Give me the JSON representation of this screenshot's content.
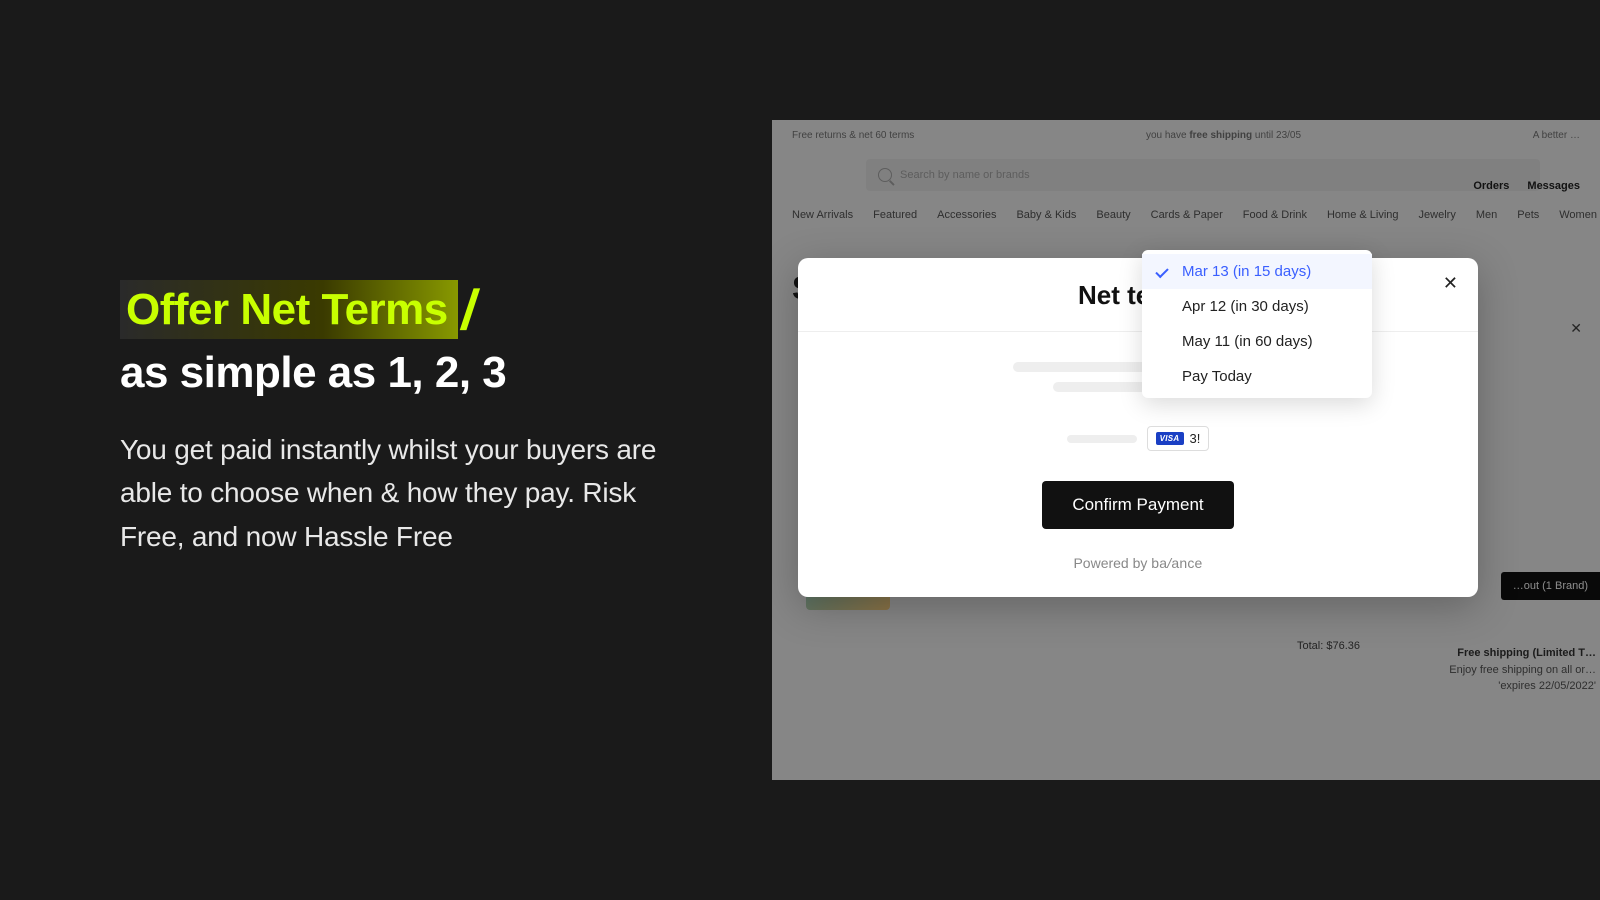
{
  "hero": {
    "line1": "Offer Net Terms",
    "slash": "/",
    "line2": "as simple as 1, 2, 3",
    "body": "You get paid instantly whilst your buyers are able to choose when & how they pay. Risk Free, and now Hassle Free"
  },
  "bg": {
    "promo_left": "Free returns & net 60 terms",
    "promo_mid_pre": "you have ",
    "promo_mid_bold": "free shipping",
    "promo_mid_post": " until 23/05",
    "promo_right": "A better …",
    "search_placeholder": "Search by name or brands",
    "toplinks": {
      "orders": "Orders",
      "messages": "Messages"
    },
    "categories": [
      "New Arrivals",
      "Featured",
      "Accessories",
      "Baby & Kids",
      "Beauty",
      "Cards & Paper",
      "Food & Drink",
      "Home & Living",
      "Jewelry",
      "Men",
      "Pets",
      "Women"
    ],
    "big_initial": "S",
    "total_label": "Total: $76.36",
    "checkout_label": "…out (1 Brand)",
    "ship_title": "Free shipping (Limited T…",
    "ship_body": "Enjoy free shipping on all or…",
    "ship_exp": "'expires 22/05/2022'"
  },
  "modal": {
    "title": "Net terms",
    "close": "✕",
    "card_brand": "VISA",
    "card_digits": "3!",
    "confirm_label": "Confirm Payment",
    "powered_prefix": "Powered by ",
    "powered_brand_a": "ba",
    "powered_brand_slash": "/",
    "powered_brand_b": "ance"
  },
  "dropdown": {
    "items": [
      {
        "label": "Mar 13 (in 15 days)",
        "selected": true
      },
      {
        "label": "Apr 12 (in 30 days)",
        "selected": false
      },
      {
        "label": "May 11 (in 60 days)",
        "selected": false
      },
      {
        "label": "Pay Today",
        "selected": false
      }
    ]
  }
}
